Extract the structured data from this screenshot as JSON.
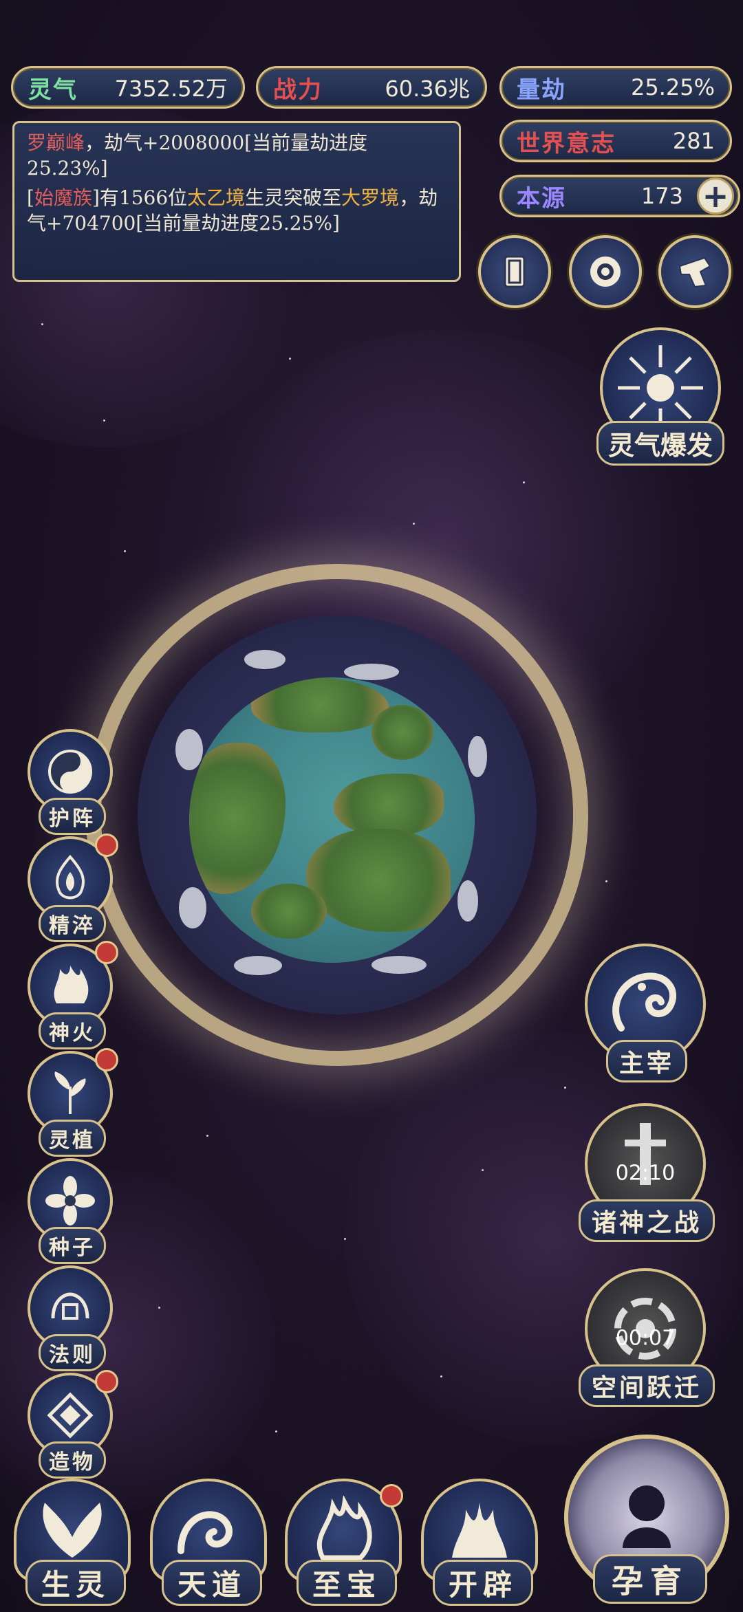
{
  "stats": {
    "lingqi": {
      "label": "灵气",
      "value": "7352.52万",
      "color": "#7fe0a3"
    },
    "zhanli": {
      "label": "战力",
      "value": "60.36兆",
      "color": "#e45050"
    },
    "liangjie": {
      "label": "量劫",
      "value": "25.25%",
      "color": "#8aa4ff"
    },
    "shijie": {
      "label": "世界意志",
      "value": "281",
      "color": "#e45050"
    },
    "benyuan": {
      "label": "本源",
      "value": "173",
      "color": "#9c86ff"
    }
  },
  "log": {
    "line1_name": "罗巅峰",
    "line1_text": "，劫气+2008000[当前量劫进度25.23%]",
    "line2_open": "[",
    "line2_race": "始魔族",
    "line2_mid": "]有1566位",
    "line2_realm1": "太乙境",
    "line2_mid2": "生灵突破至",
    "line2_realm2": "大罗境",
    "line2_end": "，劫气+704700[当前量劫进度25.25%]"
  },
  "features": {
    "burst": "灵气爆发",
    "zhuzai": "主宰",
    "zhushen": "诸神之战",
    "zhushen_timer": "02:10",
    "kongjian": "空间跃迁",
    "kongjian_timer": "00:07",
    "yunyu": "孕育"
  },
  "left_menu": [
    {
      "label": "护阵",
      "badge": false
    },
    {
      "label": "精淬",
      "badge": true
    },
    {
      "label": "神火",
      "badge": true
    },
    {
      "label": "灵植",
      "badge": true
    },
    {
      "label": "种子",
      "badge": false
    },
    {
      "label": "法则",
      "badge": false
    },
    {
      "label": "造物",
      "badge": true
    }
  ],
  "bottom_menu": [
    {
      "label": "生灵",
      "badge": false
    },
    {
      "label": "天道",
      "badge": false
    },
    {
      "label": "至宝",
      "badge": true
    },
    {
      "label": "开辟",
      "badge": false
    }
  ]
}
